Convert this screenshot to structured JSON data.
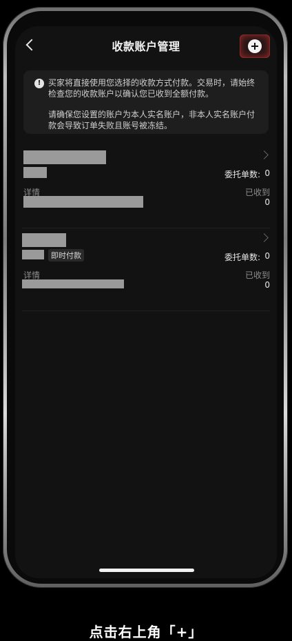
{
  "header": {
    "title": "收款账户管理",
    "back_icon": "chevron-left-icon",
    "add_icon": "plus-circle-icon"
  },
  "notice": {
    "icon": "info-icon",
    "paragraph1": "买家将直接使用您选择的收款方式付款。交易时，请始终检查您的收款账户以确认您已收到全额付款。",
    "paragraph2": "请确保您设置的账户为本人实名账户，非本人实名账户付款会导致订单失败且账号被冻结。"
  },
  "accounts": [
    {
      "tag": "",
      "order_label": "委托单数:",
      "order_count": "0",
      "details_label": "详情",
      "received_label": "已收到",
      "received_value": "0"
    },
    {
      "tag": "即时付款",
      "order_label": "委托单数:",
      "order_count": "0",
      "details_label": "详情",
      "received_label": "已收到",
      "received_value": "0"
    }
  ],
  "caption": "点击右上角「+」",
  "colors": {
    "background": "#121212",
    "highlight": "#ff3c3c"
  }
}
